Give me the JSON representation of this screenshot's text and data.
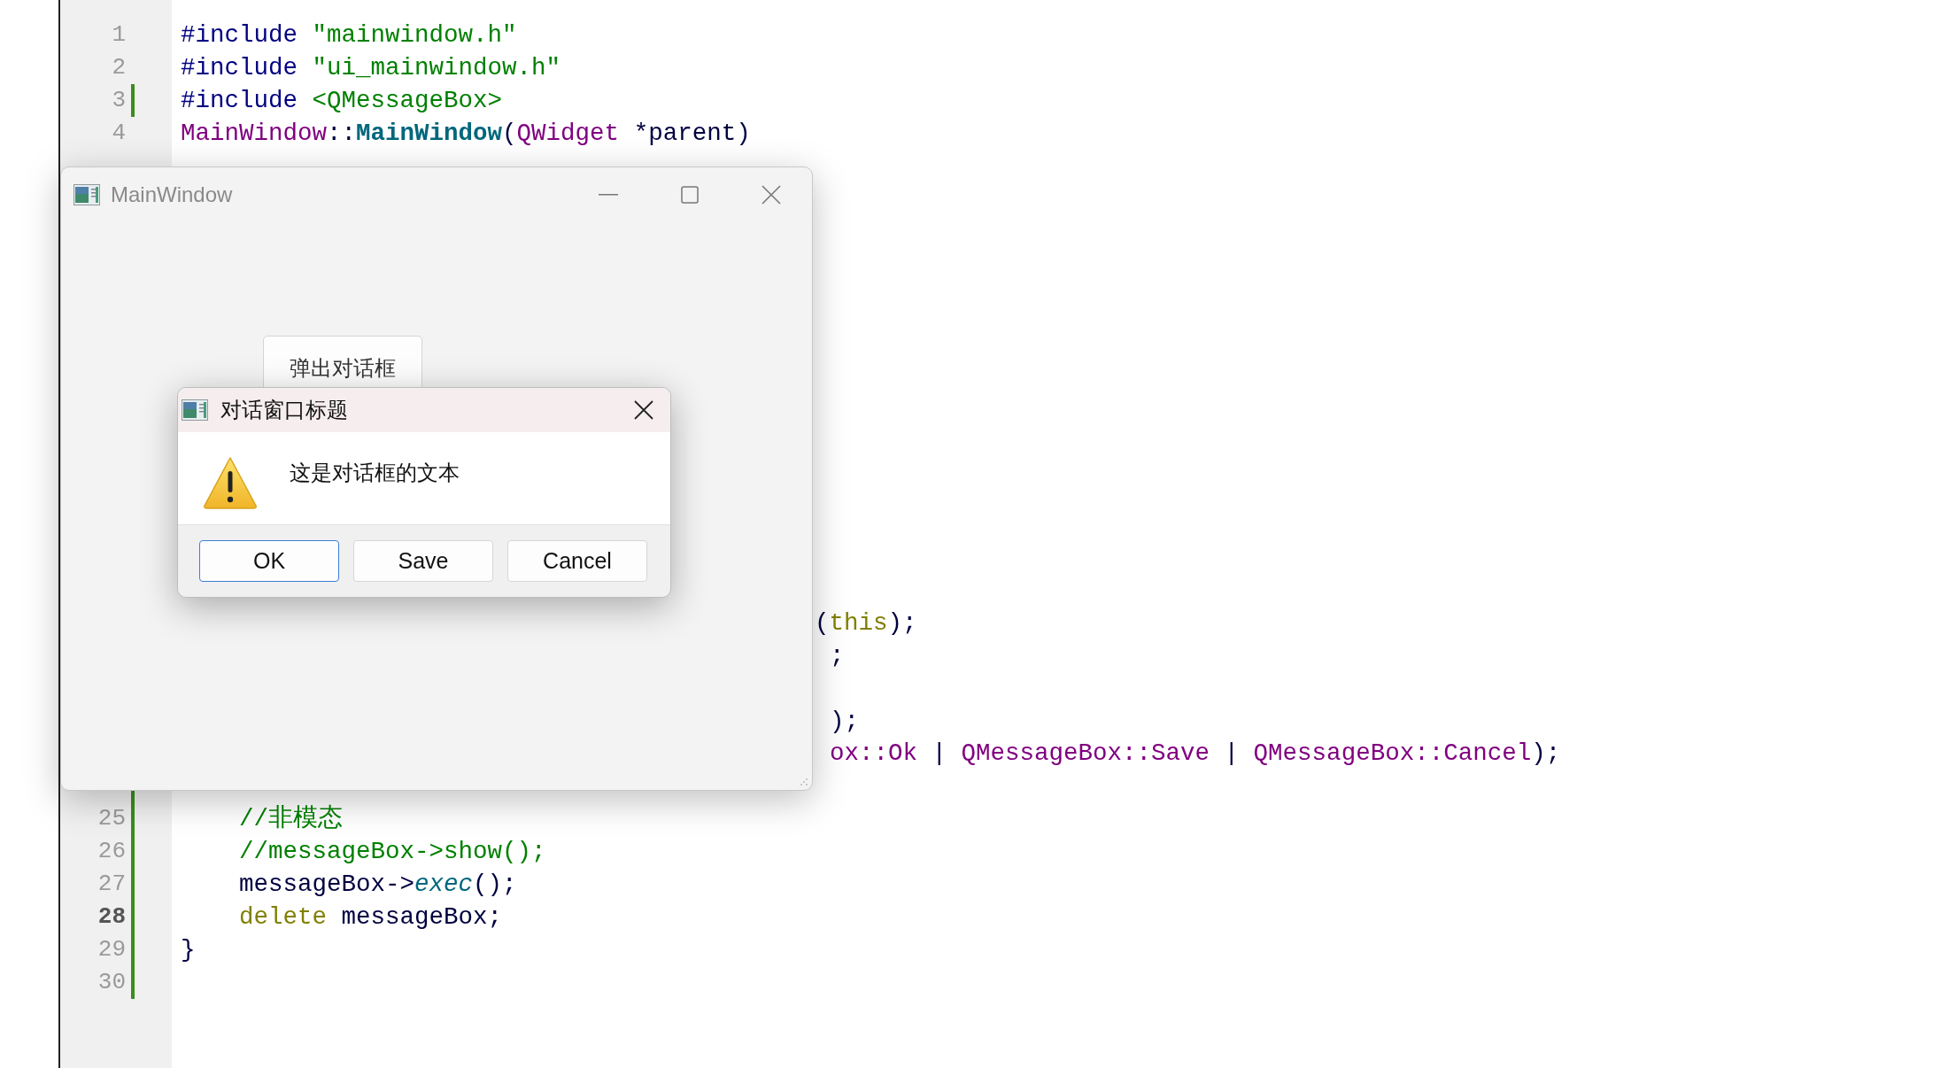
{
  "editor": {
    "top_lines": [
      {
        "number": "1",
        "current": false,
        "modified": false,
        "tokens": [
          {
            "text": "#include ",
            "kind": "directive"
          },
          {
            "text": "\"mainwindow.h\"",
            "kind": "string"
          }
        ]
      },
      {
        "number": "2",
        "current": false,
        "modified": false,
        "tokens": [
          {
            "text": "#include ",
            "kind": "directive"
          },
          {
            "text": "\"ui_mainwindow.h\"",
            "kind": "string"
          }
        ]
      },
      {
        "number": "3",
        "current": false,
        "modified": true,
        "tokens": [
          {
            "text": "#include ",
            "kind": "directive"
          },
          {
            "text": "<QMessageBox>",
            "kind": "string"
          }
        ]
      },
      {
        "number": "4",
        "current": false,
        "modified": false,
        "tokens": [
          {
            "text": "MainWindow",
            "kind": "type"
          },
          {
            "text": "::",
            "kind": "plain"
          },
          {
            "text": "MainWindow",
            "kind": "function"
          },
          {
            "text": "(",
            "kind": "plain"
          },
          {
            "text": "QWidget",
            "kind": "type"
          },
          {
            "text": " *parent)",
            "kind": "plain"
          }
        ]
      }
    ],
    "right_fragments": [
      {
        "tokens": [
          {
            "text": "(",
            "kind": "plain"
          },
          {
            "text": "this",
            "kind": "keyword"
          },
          {
            "text": ");",
            "kind": "plain"
          }
        ]
      },
      {
        "tokens": [
          {
            "text": ";",
            "kind": "plain"
          }
        ]
      },
      {
        "tokens": [
          {
            "text": ");",
            "kind": "plain"
          }
        ]
      },
      {
        "tokens": [
          {
            "text": "ox::Ok",
            "kind": "type"
          },
          {
            "text": " | ",
            "kind": "plain"
          },
          {
            "text": "QMessageBox::Save",
            "kind": "type"
          },
          {
            "text": " | ",
            "kind": "plain"
          },
          {
            "text": "QMessageBox::Cancel",
            "kind": "type"
          },
          {
            "text": ");",
            "kind": "plain"
          }
        ]
      }
    ],
    "bottom_lines": [
      {
        "current": false,
        "modified": true
      },
      {
        "number": "25",
        "current": false,
        "modified": true,
        "tokens": [
          {
            "text": "    //非模态",
            "kind": "comment"
          }
        ]
      },
      {
        "number": "26",
        "current": false,
        "modified": true,
        "tokens": [
          {
            "text": "    //messageBox->show();",
            "kind": "comment"
          }
        ]
      },
      {
        "number": "27",
        "current": false,
        "modified": true,
        "tokens": [
          {
            "text": "    messageBox->",
            "kind": "plain"
          },
          {
            "text": "exec",
            "kind": "virtual"
          },
          {
            "text": "();",
            "kind": "plain"
          }
        ]
      },
      {
        "number": "28",
        "current": true,
        "modified": true,
        "tokens": [
          {
            "text": "    delete",
            "kind": "keyword"
          },
          {
            "text": " messageBox;",
            "kind": "plain"
          }
        ]
      },
      {
        "number": "29",
        "current": false,
        "modified": true,
        "tokens": [
          {
            "text": "}",
            "kind": "plain"
          }
        ]
      },
      {
        "number": "30",
        "current": false,
        "modified": true
      }
    ]
  },
  "main_window": {
    "title": "MainWindow",
    "button": "弹出对话框"
  },
  "dialog": {
    "title": "对话窗口标题",
    "message": "这是对话框的文本",
    "buttons": [
      {
        "label": "OK",
        "selected": true
      },
      {
        "label": "Save",
        "selected": false
      },
      {
        "label": "Cancel",
        "selected": false
      }
    ]
  }
}
